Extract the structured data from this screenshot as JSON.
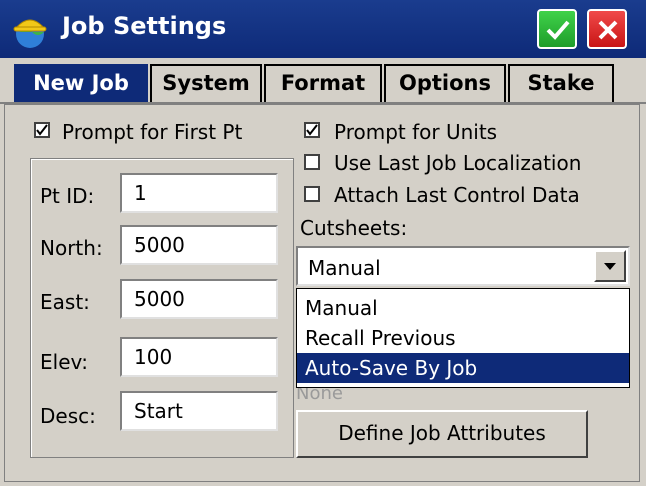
{
  "window": {
    "title": "Job Settings"
  },
  "tabs": [
    "New Job",
    "System",
    "Format",
    "Options",
    "Stake"
  ],
  "checkboxes": {
    "prompt_first_pt": {
      "label": "Prompt for First Pt",
      "checked": true
    },
    "prompt_units": {
      "label": "Prompt for Units",
      "checked": true
    },
    "use_last_localization": {
      "label": "Use Last Job Localization",
      "checked": false
    },
    "attach_control": {
      "label": "Attach Last Control Data",
      "checked": false
    }
  },
  "fields": {
    "pt_id": {
      "label": "Pt ID:",
      "value": "1"
    },
    "north": {
      "label": "North:",
      "value": "5000"
    },
    "east": {
      "label": "East:",
      "value": "5000"
    },
    "elev": {
      "label": "Elev:",
      "value": "100"
    },
    "desc": {
      "label": "Desc:",
      "value": "Start"
    }
  },
  "cutsheets": {
    "label": "Cutsheets:",
    "selected": "Manual",
    "options": [
      "Manual",
      "Recall Previous",
      "Auto-Save By Job"
    ],
    "highlighted": "Auto-Save By Job"
  },
  "attributes_hint": "None",
  "define_button": "Define Job Attributes",
  "colors": {
    "titlebar": "#0e2a78",
    "accent_ok": "#2bb836",
    "accent_cancel": "#d91f1f"
  }
}
